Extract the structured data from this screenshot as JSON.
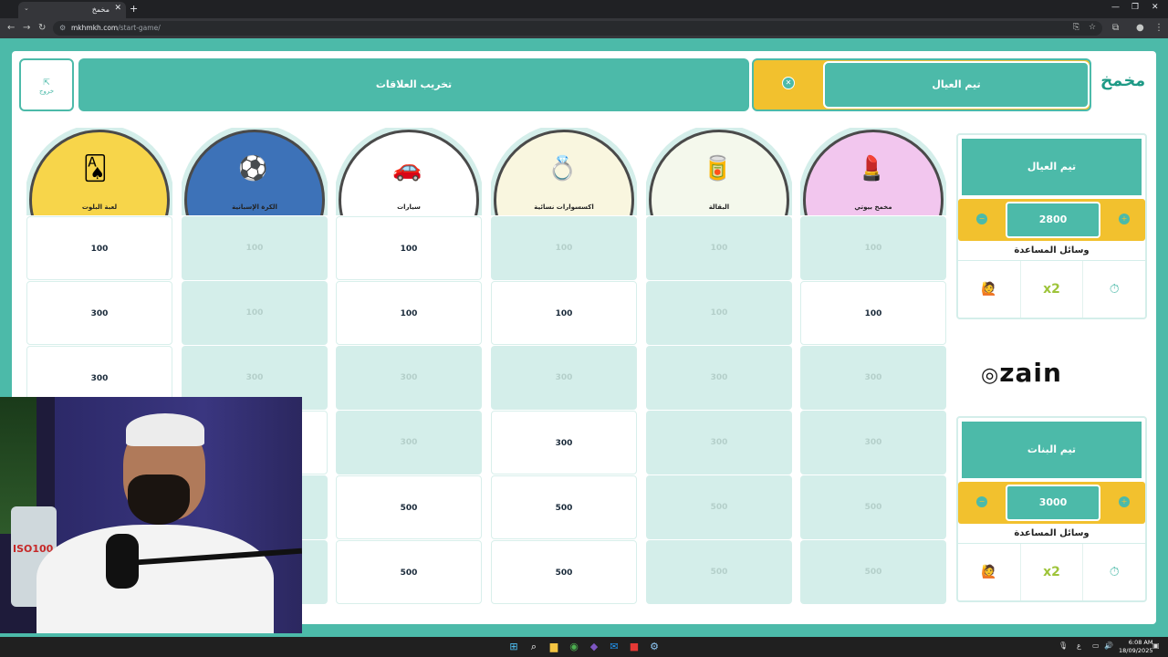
{
  "browser": {
    "tab_title": "مخمخ",
    "url_host": "mkhmkh.com",
    "url_path": "/start-game/"
  },
  "header": {
    "exit_label": "خروج",
    "round_title": "تخريب العلاقات",
    "current_turn_team": "تيم العيال"
  },
  "categories": [
    {
      "label": "لعبة البلوت",
      "art": "🂡",
      "halo": "#f7d54a",
      "cells": [
        {
          "value": "100",
          "state": "avail"
        },
        {
          "value": "300",
          "state": "avail"
        },
        {
          "value": "300",
          "state": "avail"
        },
        {
          "value": "",
          "state": "avail"
        },
        {
          "value": "",
          "state": "used"
        },
        {
          "value": "",
          "state": "used"
        }
      ]
    },
    {
      "label": "الكرة الإسبانية",
      "art": "⚽",
      "halo": "#3d72b8",
      "cells": [
        {
          "value": "100",
          "state": "used"
        },
        {
          "value": "100",
          "state": "used"
        },
        {
          "value": "300",
          "state": "used"
        },
        {
          "value": "",
          "state": "avail"
        },
        {
          "value": "",
          "state": "used"
        },
        {
          "value": "",
          "state": "used"
        }
      ]
    },
    {
      "label": "سيارات",
      "art": "🚗",
      "halo": "#ffffff",
      "cells": [
        {
          "value": "100",
          "state": "avail"
        },
        {
          "value": "100",
          "state": "avail"
        },
        {
          "value": "300",
          "state": "used"
        },
        {
          "value": "300",
          "state": "used"
        },
        {
          "value": "500",
          "state": "avail"
        },
        {
          "value": "500",
          "state": "avail"
        }
      ]
    },
    {
      "label": "اكسسوارات نسائية",
      "art": "💍",
      "halo": "#f9f6df",
      "cells": [
        {
          "value": "100",
          "state": "used"
        },
        {
          "value": "100",
          "state": "avail"
        },
        {
          "value": "300",
          "state": "used"
        },
        {
          "value": "300",
          "state": "avail"
        },
        {
          "value": "500",
          "state": "avail"
        },
        {
          "value": "500",
          "state": "avail"
        }
      ]
    },
    {
      "label": "البقالة",
      "art": "🥫",
      "halo": "#f4f8ec",
      "cells": [
        {
          "value": "100",
          "state": "used"
        },
        {
          "value": "100",
          "state": "used"
        },
        {
          "value": "300",
          "state": "used"
        },
        {
          "value": "300",
          "state": "used"
        },
        {
          "value": "500",
          "state": "used"
        },
        {
          "value": "500",
          "state": "used"
        }
      ]
    },
    {
      "label": "مخمخ بيوتي",
      "art": "💄",
      "halo": "#f2c6ee",
      "cells": [
        {
          "value": "100",
          "state": "used"
        },
        {
          "value": "100",
          "state": "avail"
        },
        {
          "value": "300",
          "state": "used"
        },
        {
          "value": "300",
          "state": "used"
        },
        {
          "value": "500",
          "state": "used"
        },
        {
          "value": "500",
          "state": "used"
        }
      ]
    }
  ],
  "teams": [
    {
      "name": "تيم العيال",
      "score": "2800",
      "help_title": "وسائل المساعدة",
      "help": [
        "🙋",
        "x2",
        "⏱"
      ]
    },
    {
      "name": "تيم البنات",
      "score": "3000",
      "help_title": "وسائل المساعدة",
      "help": [
        "🙋",
        "x2",
        "⏱"
      ]
    }
  ],
  "sponsor": "zain",
  "taskbar": {
    "time": "6:08 AM",
    "date": "18/09/2025",
    "lang": "ع"
  },
  "colors": {
    "teal": "#4cbaa9",
    "yellow": "#f2c12e",
    "used_cell": "#d4eeea"
  }
}
